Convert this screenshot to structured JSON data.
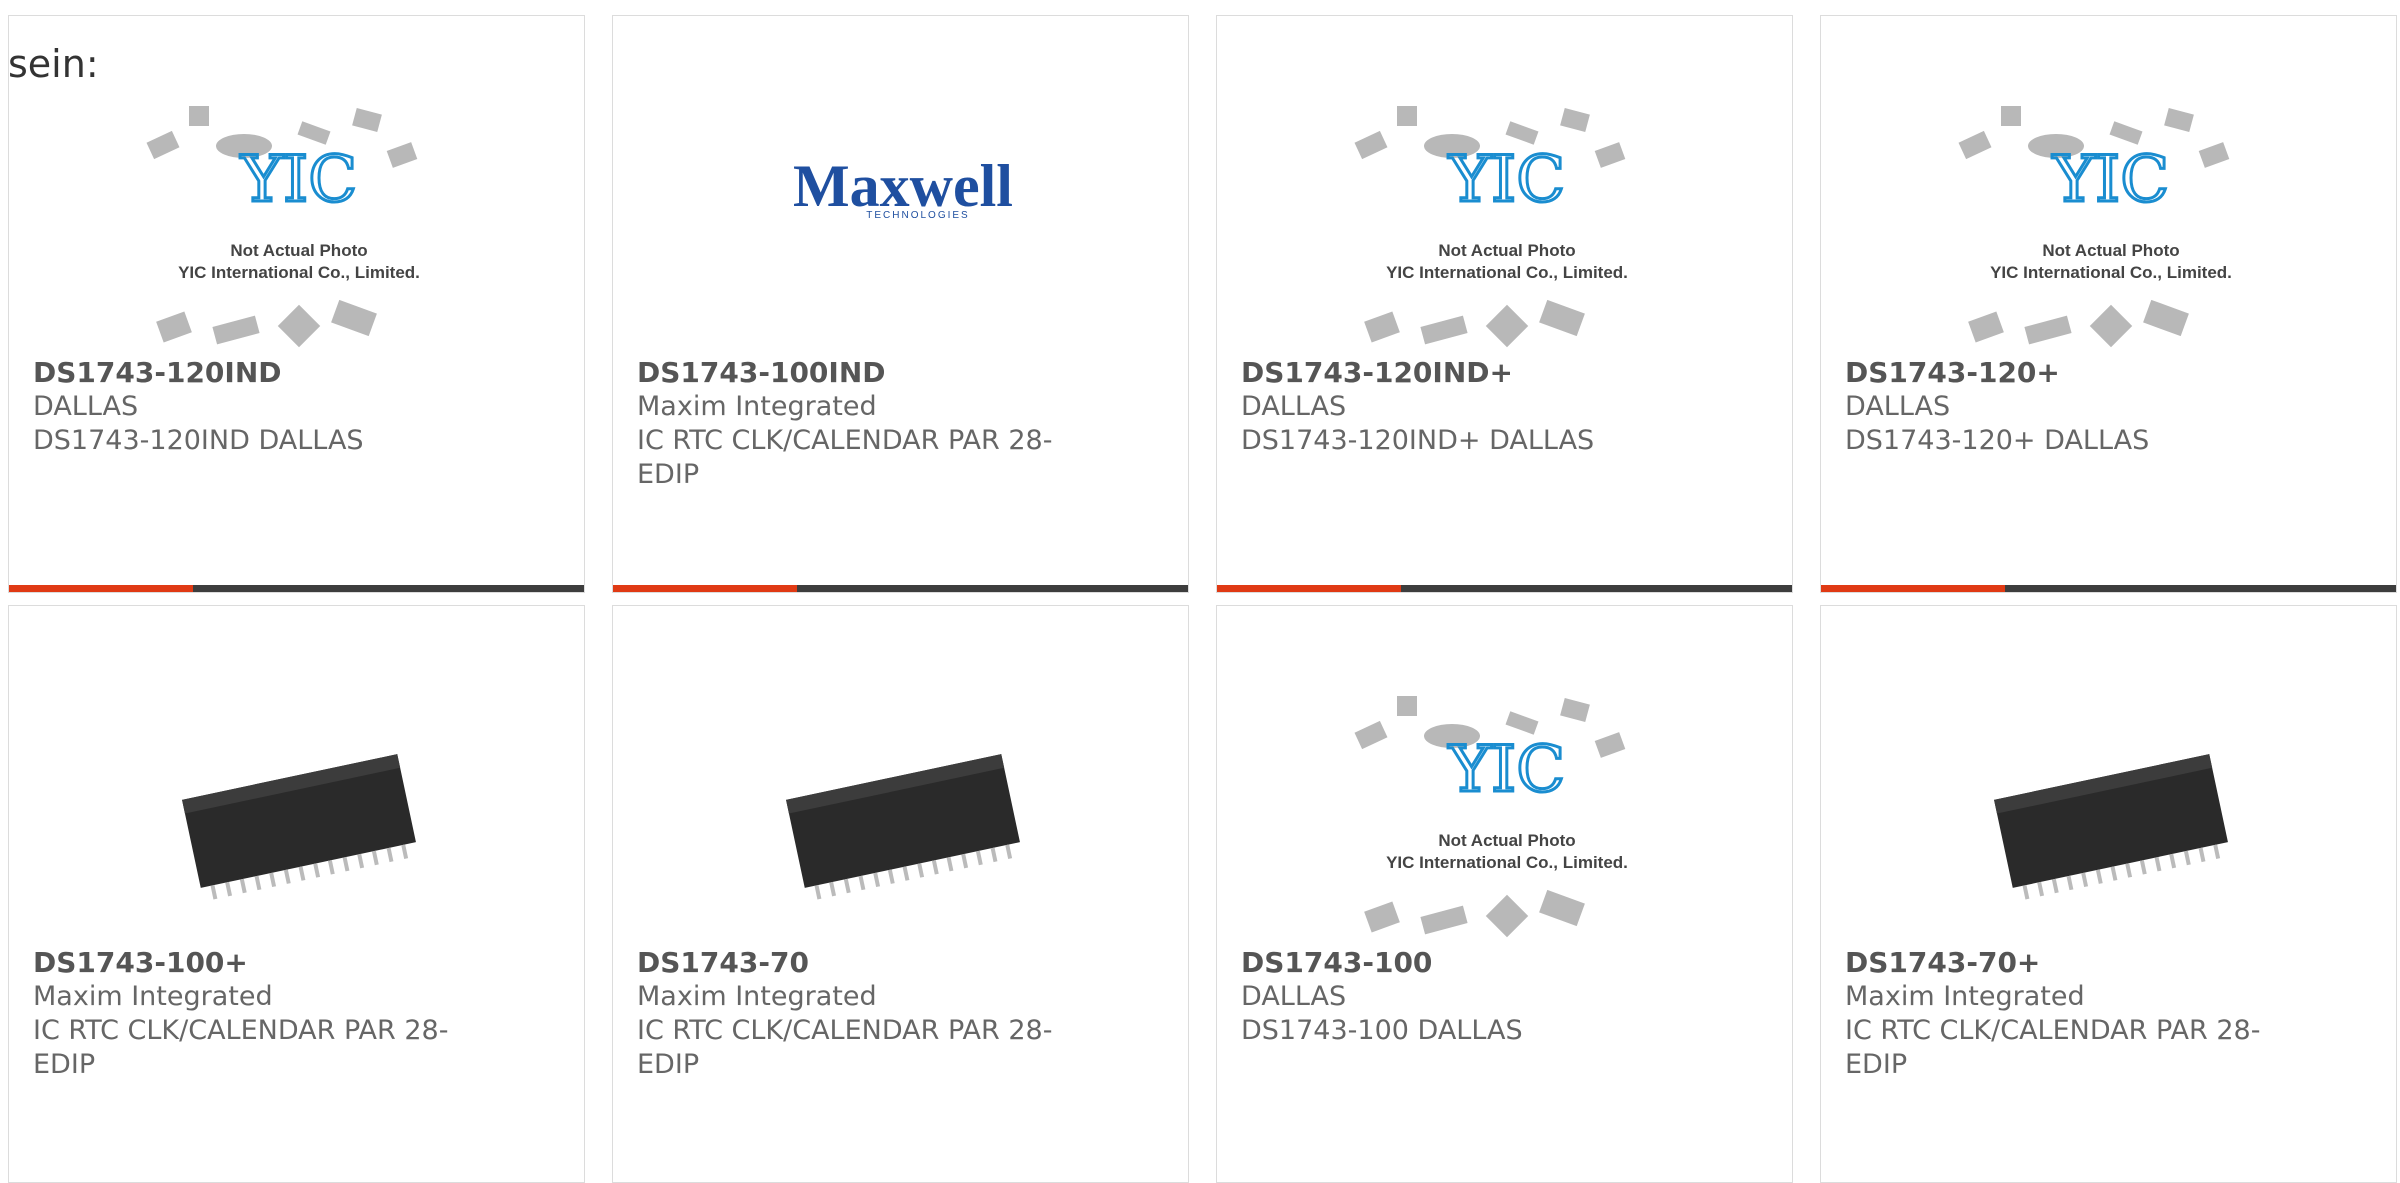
{
  "intro": "sein:",
  "placeholder": {
    "line1": "Not Actual Photo",
    "line2": "YIC International Co., Limited."
  },
  "maxwell_logo": {
    "word": "Maxwell",
    "sub": "TECHNOLOGIES"
  },
  "colors": {
    "accent": "#e03a14",
    "bar": "#3d3d3d"
  },
  "products": [
    {
      "pn": "DS1743-120IND",
      "mfr": "DALLAS",
      "desc": "DS1743-120IND DALLAS",
      "image": "yic-placeholder"
    },
    {
      "pn": "DS1743-100IND",
      "mfr": "Maxim Integrated",
      "desc": "IC RTC CLK/CALENDAR PAR 28-EDIP",
      "image": "maxwell-logo"
    },
    {
      "pn": "DS1743-120IND+",
      "mfr": "DALLAS",
      "desc": "DS1743-120IND+ DALLAS",
      "image": "yic-placeholder"
    },
    {
      "pn": "DS1743-120+",
      "mfr": "DALLAS",
      "desc": "DS1743-120+ DALLAS",
      "image": "yic-placeholder"
    },
    {
      "pn": "DS1743-100+",
      "mfr": "Maxim Integrated",
      "desc": "IC RTC CLK/CALENDAR PAR 28-EDIP",
      "image": "chip-photo"
    },
    {
      "pn": "DS1743-70",
      "mfr": "Maxim Integrated",
      "desc": "IC RTC CLK/CALENDAR PAR 28-EDIP",
      "image": "chip-photo"
    },
    {
      "pn": "DS1743-100",
      "mfr": "DALLAS",
      "desc": "DS1743-100 DALLAS",
      "image": "yic-placeholder"
    },
    {
      "pn": "DS1743-70+",
      "mfr": "Maxim Integrated",
      "desc": "IC RTC CLK/CALENDAR PAR 28-EDIP",
      "image": "chip-photo"
    }
  ]
}
